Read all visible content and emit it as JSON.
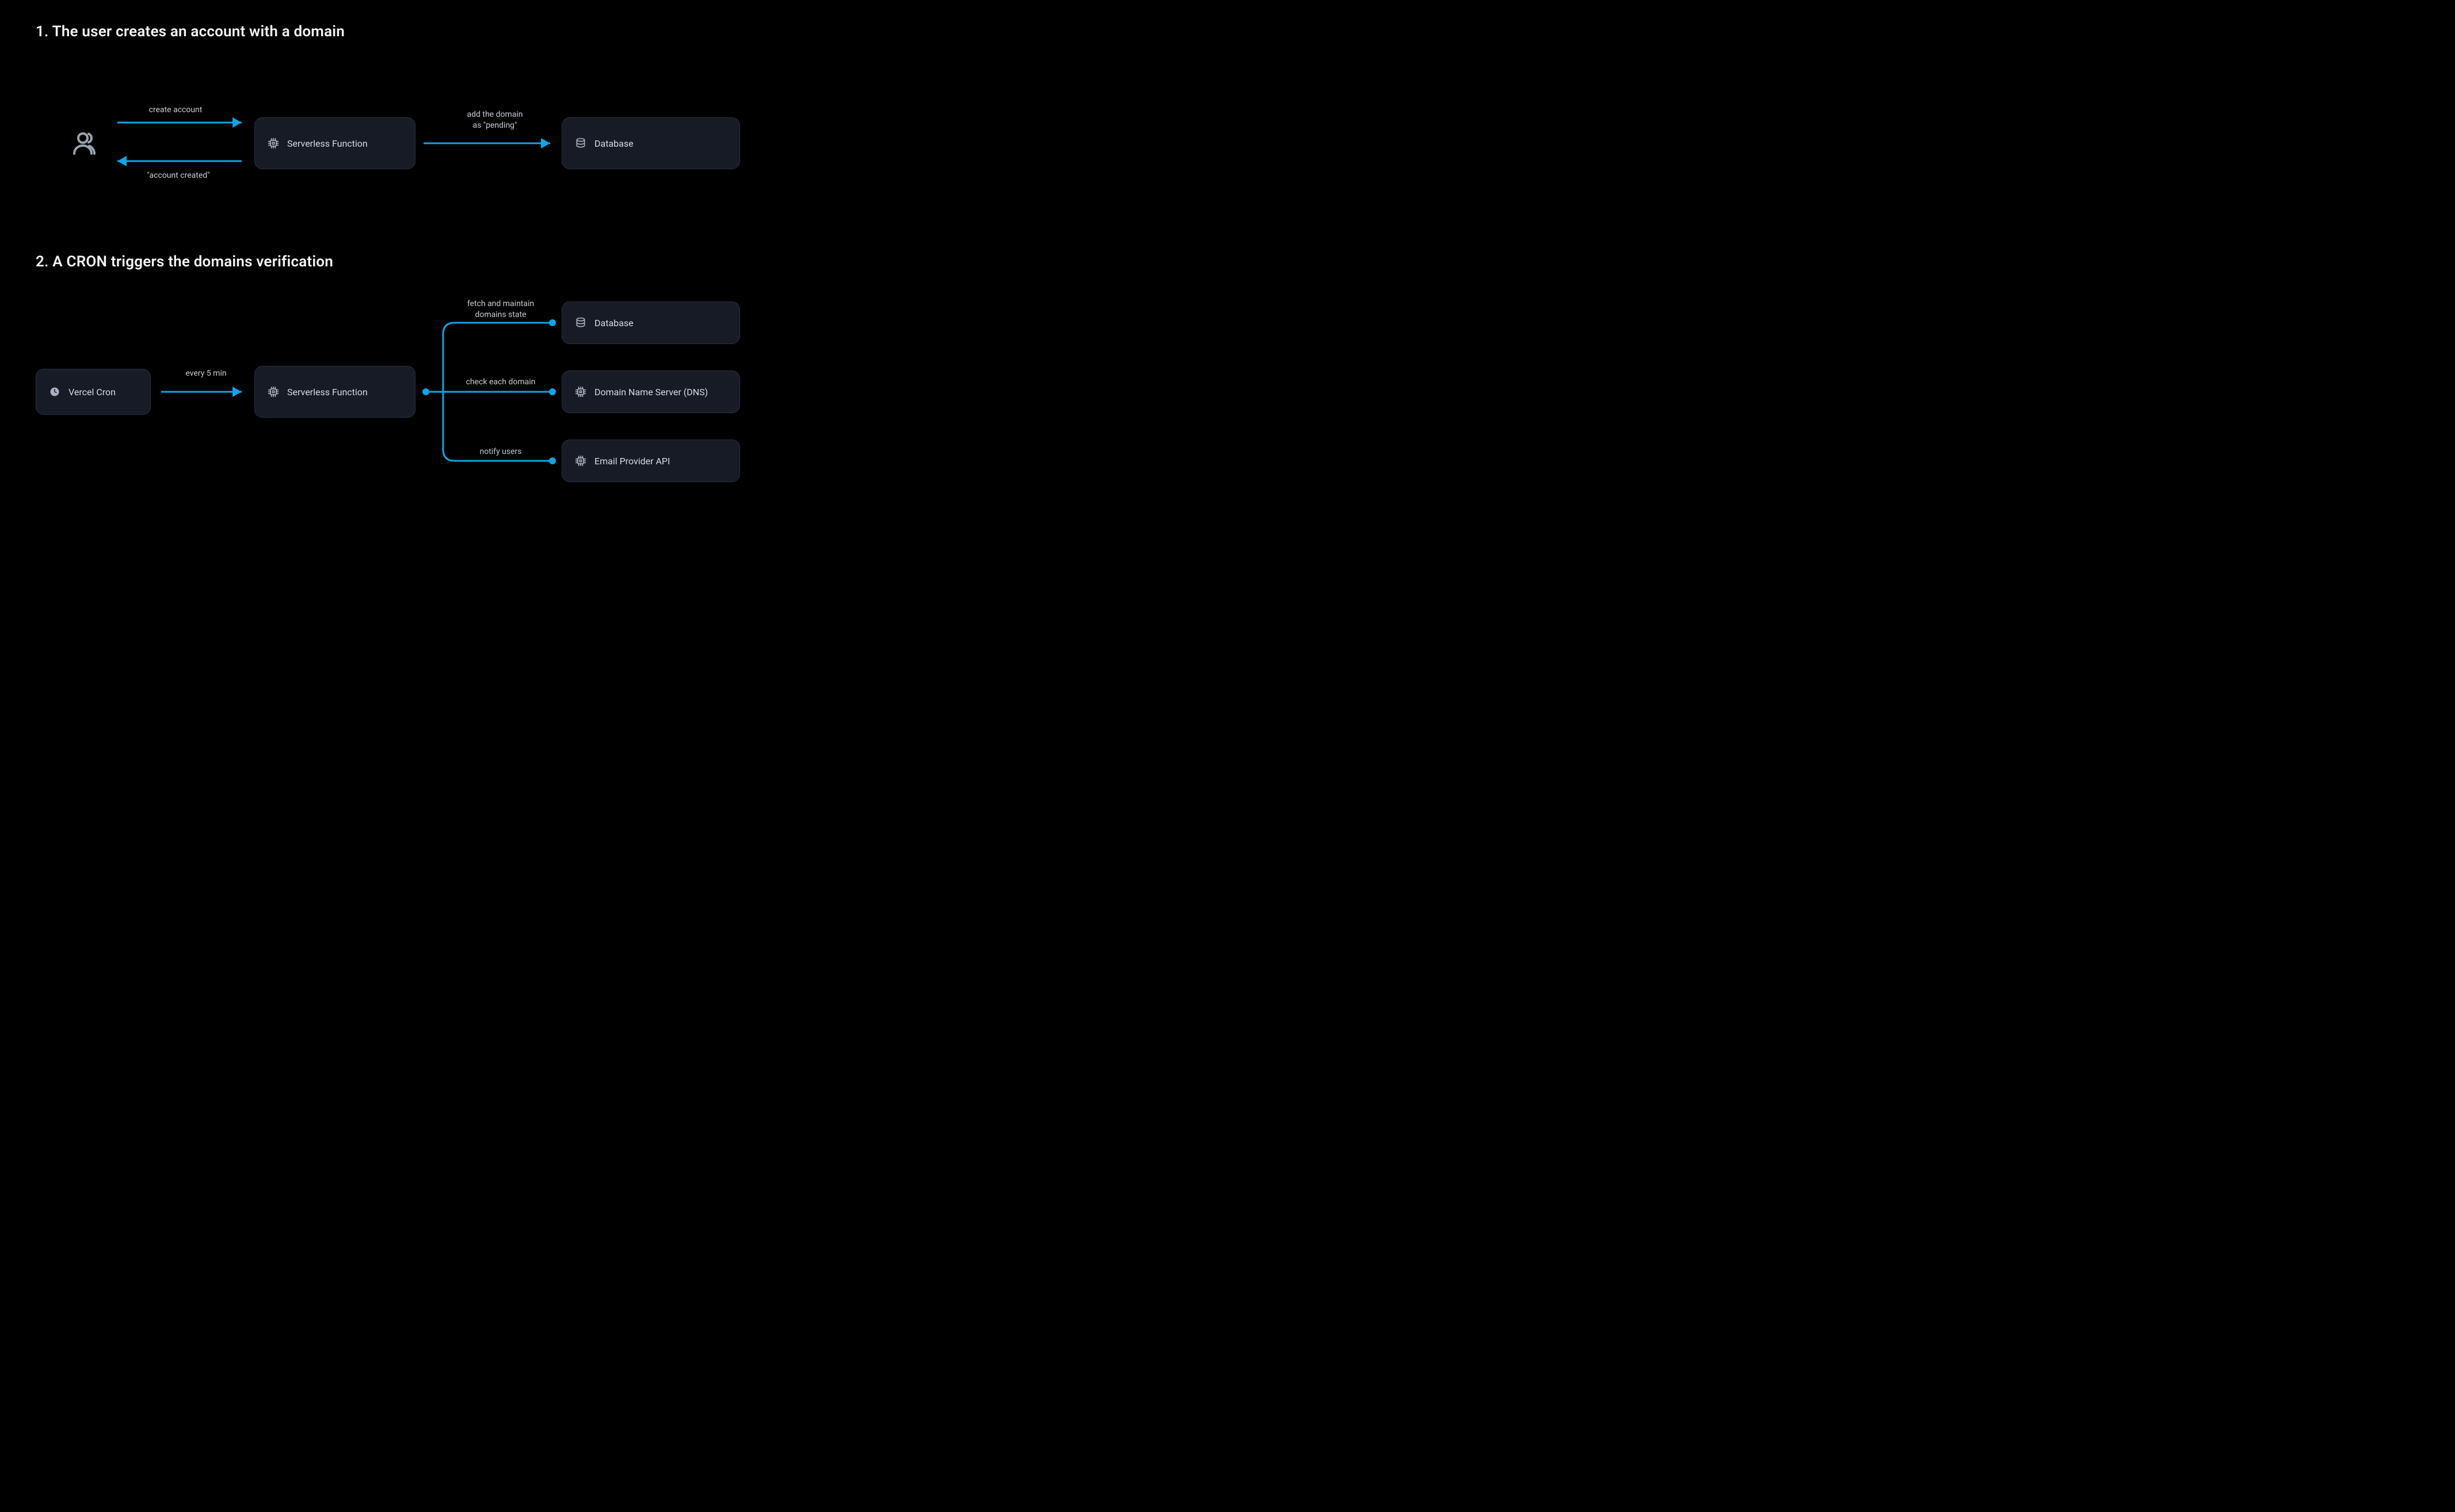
{
  "section1": {
    "heading": "1. The user creates an account with a domain",
    "arrows": {
      "create_account": "create account",
      "account_created": "\"account created\"",
      "add_domain_pending": "add the domain\nas \"pending\""
    },
    "nodes": {
      "serverless_function": "Serverless Function",
      "database": "Database"
    }
  },
  "section2": {
    "heading": "2. A CRON triggers the domains verification",
    "nodes": {
      "vercel_cron": "Vercel Cron",
      "serverless_function": "Serverless Function",
      "database": "Database",
      "dns": "Domain Name Server (DNS)",
      "email_provider": "Email Provider API"
    },
    "arrows": {
      "every_5_min": "every 5 min",
      "fetch_maintain": "fetch and maintain\ndomains state",
      "check_each_domain": "check each domain",
      "notify_users": "notify users"
    }
  },
  "colors": {
    "accent": "#0ea5e9",
    "node_bg": "#161b26",
    "node_border": "#2a3040",
    "icon": "#a9b0bf"
  }
}
